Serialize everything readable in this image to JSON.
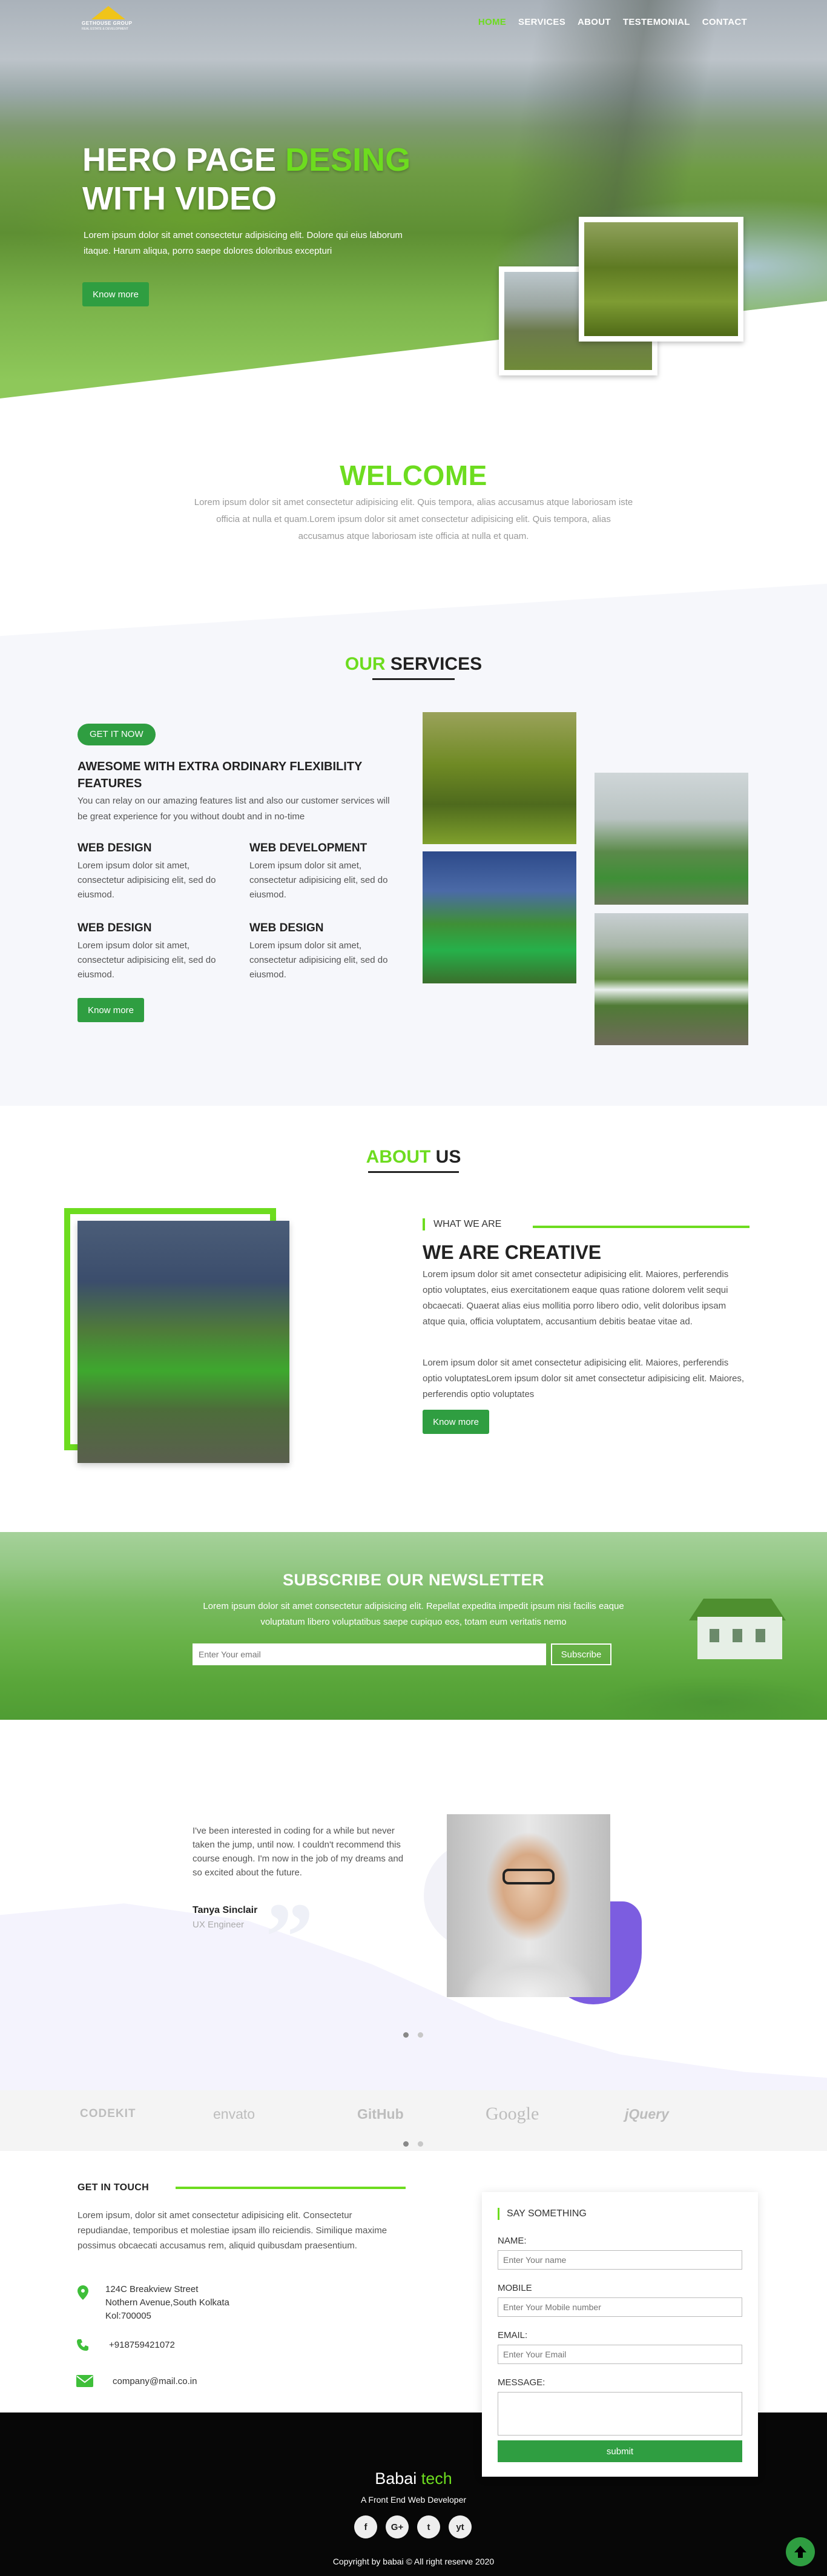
{
  "nav": {
    "logo_text": "GETHOUSE GROUP",
    "logo_subtext": "REAL ESTATE & DEVELOPMENT",
    "links": [
      "HOME",
      "SERVICES",
      "ABOUT",
      "TESTEMONIAL",
      "CONTACT"
    ],
    "active_link": "HOME"
  },
  "hero": {
    "title_part1": "HERO PAGE ",
    "title_highlight": "DESING",
    "title_part2": "WITH VIDEO",
    "text": "Lorem ipsum dolor sit amet consectetur adipisicing elit. Dolore qui eius laborum itaque. Harum aliqua, porro saepe dolores doloribus excepturi",
    "button": "Know more"
  },
  "welcome": {
    "title": "WELCOME",
    "text": "Lorem ipsum dolor sit amet consectetur adipisicing elit. Quis tempora, alias accusamus atque laboriosam iste officia at nulla et quam.Lorem ipsum dolor sit amet consectetur adipisicing elit. Quis tempora, alias accusamus atque laboriosam iste officia at nulla et quam."
  },
  "services": {
    "title_highlight": "OUR",
    "title_rest": " SERVICES",
    "badge": "GET IT NOW",
    "heading": "AWESOME WITH EXTRA ORDINARY FLEXIBILITY FEATURES",
    "intro": "You can relay on our amazing features list and also our customer services will be great experience for you without doubt and in no-time",
    "items": [
      {
        "title": "WEB DESIGN",
        "text": "Lorem ipsum dolor sit amet, consectetur adipisicing elit, sed do eiusmod."
      },
      {
        "title": "WEB DEVELOPMENT",
        "text": "Lorem ipsum dolor sit amet, consectetur adipisicing elit, sed do eiusmod."
      },
      {
        "title": "WEB DESIGN",
        "text": "Lorem ipsum dolor sit amet, consectetur adipisicing elit, sed do eiusmod."
      },
      {
        "title": "WEB DESIGN",
        "text": "Lorem ipsum dolor sit amet, consectetur adipisicing elit, sed do eiusmod."
      }
    ],
    "button": "Know more"
  },
  "about": {
    "title_highlight": "ABOUT",
    "title_rest": " US",
    "label": "WHAT WE ARE",
    "heading_plain": "WE ARE ",
    "heading_bold": "CREATIVE",
    "paragraph1": "Lorem ipsum dolor sit amet consectetur adipisicing elit. Maiores, perferendis optio voluptates, eius exercitationem eaque quas ratione dolorem velit sequi obcaecati. Quaerat alias eius mollitia porro libero odio, velit doloribus ipsam atque quia, officia voluptatem, accusantium debitis beatae vitae ad.",
    "paragraph2": "Lorem ipsum dolor sit amet consectetur adipisicing elit. Maiores, perferendis optio voluptatesLorem ipsum dolor sit amet consectetur adipisicing elit. Maiores, perferendis optio voluptates",
    "button": "Know more"
  },
  "newsletter": {
    "title": "SUBSCRIBE OUR NEWSLETTER",
    "text": "Lorem ipsum dolor sit amet consectetur adipisicing elit. Repellat expedita impedit ipsum nisi facilis eaque voluptatum libero voluptatibus saepe cupiquo eos, totam eum veritatis nemo",
    "input_placeholder": "Enter Your email",
    "button": "Subscribe"
  },
  "testimonial": {
    "text": "I've been interested in coding for a while but never taken the jump, until now. I couldn't recommend this course enough. I'm now in the job of my dreams and so excited about the future.",
    "name": "Tanya Sinclair",
    "role": "UX Engineer"
  },
  "brands": [
    "CODEKIT",
    "envato",
    "GitHub",
    "Google",
    "jQuery"
  ],
  "contact": {
    "title": "GET IN TOUCH",
    "text": "Lorem ipsum, dolor sit amet consectetur adipisicing elit. Consectetur repudiandae, temporibus et molestiae ipsam illo reiciendis. Similique maxime possimus obcaecati accusamus rem, aliquid quibusdam praesentium.",
    "address_line1": "124C Breakview Street",
    "address_line2": "Nothern Avenue,South Kolkata",
    "address_line3": "Kol:700005",
    "phone": "+918759421072",
    "email": "company@mail.co.in"
  },
  "form": {
    "heading": "SAY SOMETHING",
    "name_label": "NAME:",
    "name_placeholder": "Enter Your name",
    "mobile_label": "MOBILE",
    "mobile_placeholder": "Enter Your Mobile number",
    "email_label": "EMAIL:",
    "email_placeholder": "Enter Your Email",
    "message_label": "MESSAGE:",
    "submit": "submit"
  },
  "footer": {
    "brand_plain": "Babai ",
    "brand_highlight": "tech",
    "tagline": "A Front End Web Developer",
    "socials": [
      "f",
      "G+",
      "t",
      "yt"
    ],
    "copyright": "Copyright by babai © All right reserve 2020"
  },
  "colors": {
    "accent": "#6ddc1f",
    "button": "#2f9e41",
    "footer_bg": "#070707"
  }
}
